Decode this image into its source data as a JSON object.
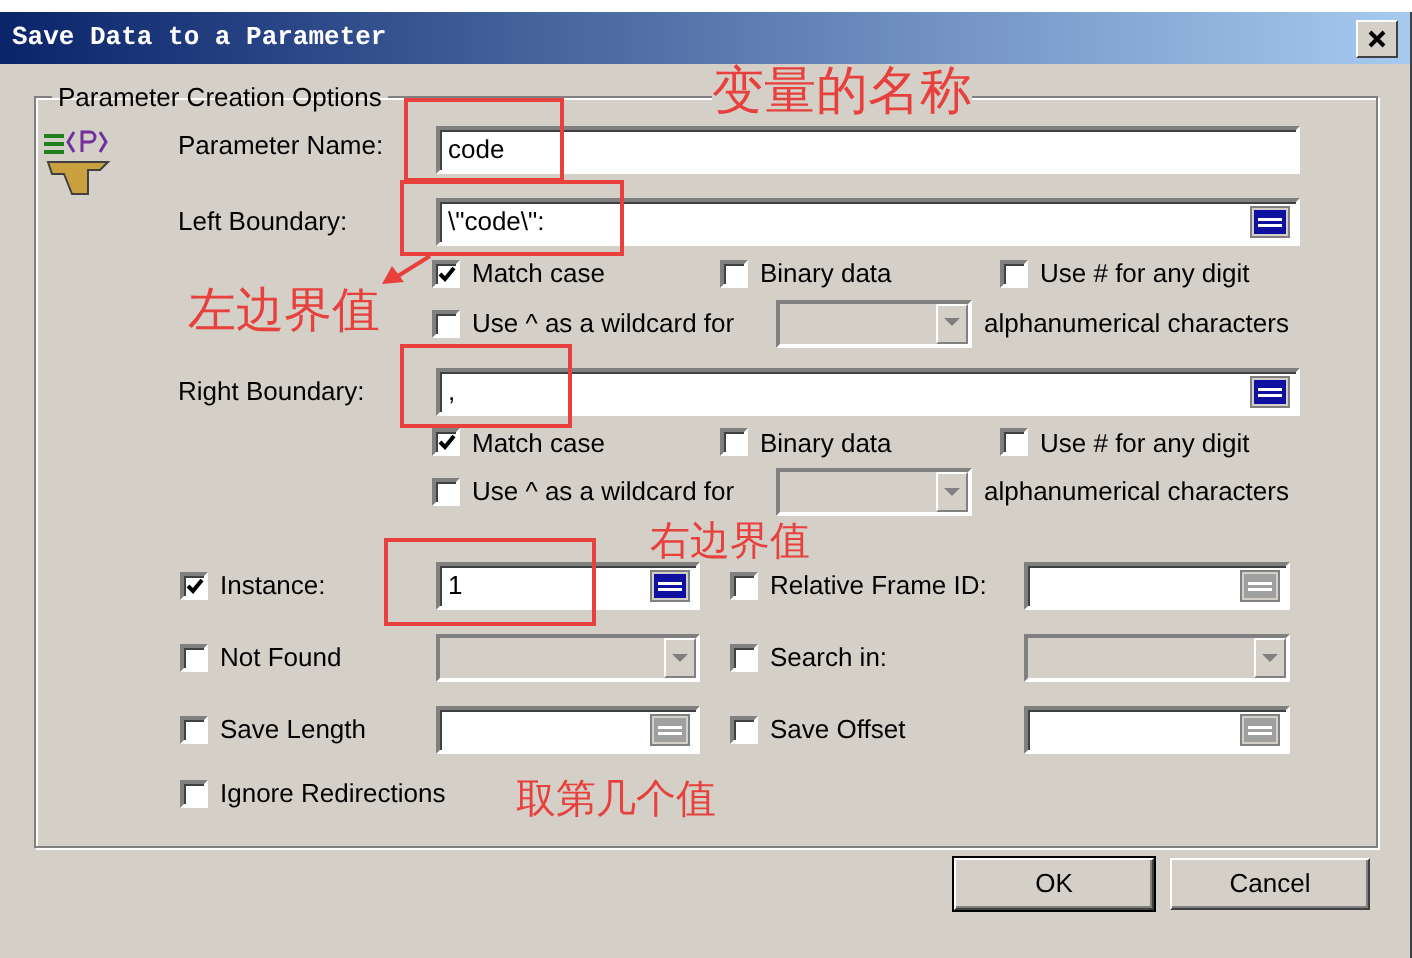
{
  "window": {
    "title": "Save Data to a Parameter"
  },
  "group": {
    "title": "Parameter Creation Options"
  },
  "name_field": {
    "label": "Parameter Name:",
    "value": "code",
    "highlighted": true,
    "note": "变量的名称"
  },
  "boundaries": [
    {
      "label": "Left Boundary:",
      "value": "\\\"code\\\":",
      "highlighted": true,
      "note": "左边界值",
      "note_arrow": true,
      "checks": [
        {
          "label": "Match case",
          "checked": true
        },
        {
          "label": "Binary data",
          "checked": false
        },
        {
          "label": "Use # for any digit",
          "checked": false
        }
      ],
      "wildcard": {
        "label": "Use ^ as a wildcard for",
        "checked": false,
        "suffix": "alphanumerical characters"
      }
    },
    {
      "label": "Right Boundary:",
      "value": ",",
      "highlighted": true,
      "note": "右边界值",
      "checks": [
        {
          "label": "Match case",
          "checked": true
        },
        {
          "label": "Binary data",
          "checked": false
        },
        {
          "label": "Use # for any digit",
          "checked": false
        }
      ],
      "wildcard": {
        "label": "Use ^ as a wildcard for",
        "checked": false,
        "suffix": "alphanumerical characters"
      }
    }
  ],
  "options": [
    [
      {
        "kind": "field",
        "label": "Instance:",
        "checked": true,
        "value": "1",
        "disabled": false,
        "highlighted": true,
        "note": "取第几个值"
      },
      {
        "kind": "field",
        "label": "Relative Frame ID:",
        "checked": false,
        "disabled": true
      }
    ],
    [
      {
        "kind": "dropdown",
        "label": "Not Found",
        "checked": false,
        "disabled": true
      },
      {
        "kind": "dropdown",
        "label": "Search in:",
        "checked": false,
        "disabled": true
      }
    ],
    [
      {
        "kind": "field",
        "label": "Save Length",
        "checked": false,
        "disabled": true
      },
      {
        "kind": "field",
        "label": "Save Offset",
        "checked": false,
        "disabled": true
      }
    ],
    [
      {
        "kind": "none",
        "label": "Ignore Redirections",
        "checked": false
      }
    ]
  ],
  "buttons": [
    {
      "label": "OK"
    },
    {
      "label": "Cancel"
    }
  ]
}
